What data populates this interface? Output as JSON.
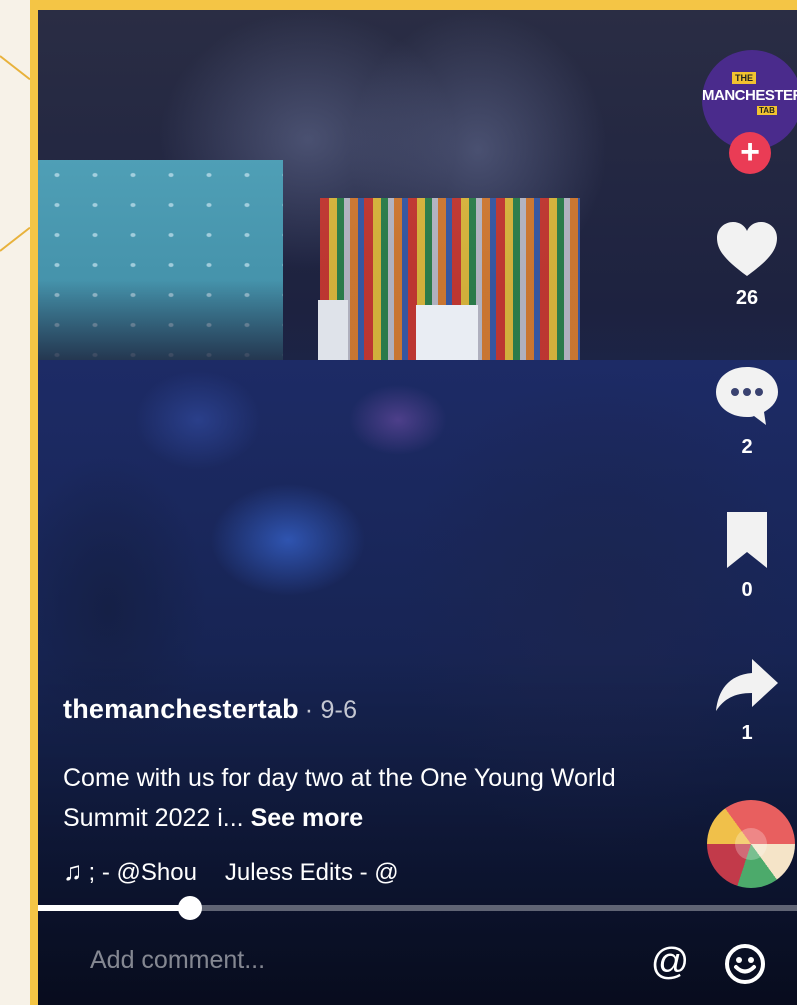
{
  "post": {
    "author": "themanchestertab",
    "date": "· 9-6",
    "caption": "Come with us for day two at the One Young World Summit 2022 i...",
    "see_more": "See more",
    "music_a": "; - @Shou",
    "music_b": "Juless Edits - @"
  },
  "avatar": {
    "tag_top": "THE",
    "brand": "MANCHESTER",
    "tag_bottom": "TAB"
  },
  "actions": {
    "likes": "26",
    "comments": "2",
    "saves": "0",
    "shares": "1"
  },
  "progress": {
    "fraction": 0.2
  },
  "comment": {
    "placeholder": "Add comment..."
  },
  "icons": [
    "plus-icon",
    "heart-icon",
    "comment-icon",
    "bookmark-icon",
    "share-icon",
    "music-note-icon",
    "at-icon",
    "emoji-icon"
  ]
}
